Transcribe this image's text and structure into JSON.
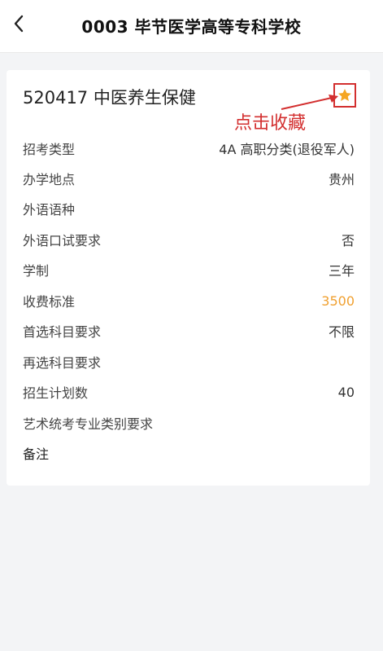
{
  "header": {
    "title": "0003 毕节医学高等专科学校"
  },
  "major": {
    "code_name": "520417 中医养生保健",
    "favorite_annotation": "点击收藏"
  },
  "fields": [
    {
      "label": "招考类型",
      "value": "4A 高职分类(退役军人)"
    },
    {
      "label": "办学地点",
      "value": "贵州"
    },
    {
      "label": "外语语种",
      "value": ""
    },
    {
      "label": "外语口试要求",
      "value": "否"
    },
    {
      "label": "学制",
      "value": "三年"
    },
    {
      "label": "收费标准",
      "value": "3500"
    },
    {
      "label": "首选科目要求",
      "value": "不限"
    },
    {
      "label": "再选科目要求",
      "value": ""
    },
    {
      "label": "招生计划数",
      "value": "40"
    },
    {
      "label": "艺术统考专业类别要求",
      "value": ""
    },
    {
      "label": "备注",
      "value": ""
    }
  ],
  "colors": {
    "accent_fee": "#f0a030",
    "annotation_red": "#d32f2f",
    "star": "#f5a623"
  },
  "icons": {
    "back": "chevron-left-icon",
    "favorite": "star-icon"
  }
}
